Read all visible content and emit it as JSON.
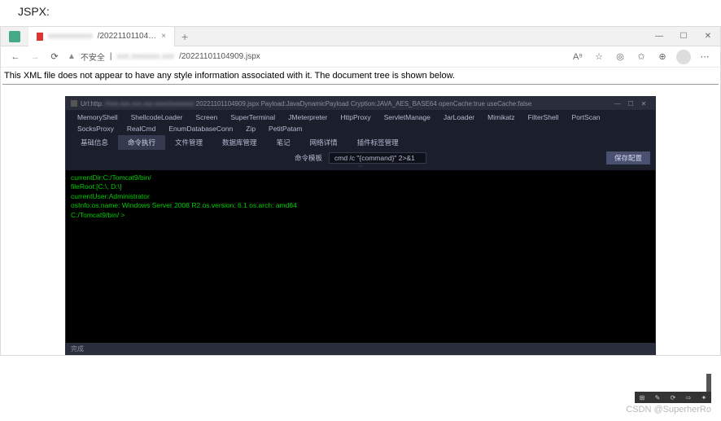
{
  "page_label": "JSPX:",
  "browser": {
    "tab_title_suffix": "/20221101104…",
    "url_suffix": "/20221101104909.jspx",
    "not_secure": "不安全",
    "xml_message": "This XML file does not appear to have any style information associated with it. The document tree is shown below."
  },
  "terminal": {
    "title_prefix": "Url:http:",
    "title_suffix": "20221101104909.jspx Payload:JavaDynamicPayload Cryption:JAVA_AES_BASE64 openCache:true useCache:false",
    "modules": [
      "MemoryShell",
      "ShellcodeLoader",
      "Screen",
      "SuperTerminal",
      "JMeterpreter",
      "HttpProxy",
      "ServletManage",
      "JarLoader",
      "Mimikatz",
      "FilterShell",
      "PortScan",
      "SocksProxy",
      "RealCmd",
      "EnumDatabaseConn",
      "Zip",
      "PetitPatam"
    ],
    "sub_tabs": [
      "基础信息",
      "命令执行",
      "文件管理",
      "数据库管理",
      "笔记",
      "网络详情",
      "插件标签管理"
    ],
    "active_sub_tab": 1,
    "cmd_template_label": "命令模板",
    "cmd_template_value": "cmd /c \"{command}\" 2>&1",
    "save_config": "保存配置",
    "console_lines": [
      "currentDir:C:/Tomcat9/bin/",
      "fileRoot:[C:\\, D:\\]",
      "currentUser:Administrator",
      "osInfo:os.name: Windows Server 2008 R2 os.version: 6.1 os.arch: amd64",
      "",
      "C:/Tomcat9/bin/ >"
    ],
    "status": "完成"
  },
  "watermark": "CSDN @SuperherRo"
}
